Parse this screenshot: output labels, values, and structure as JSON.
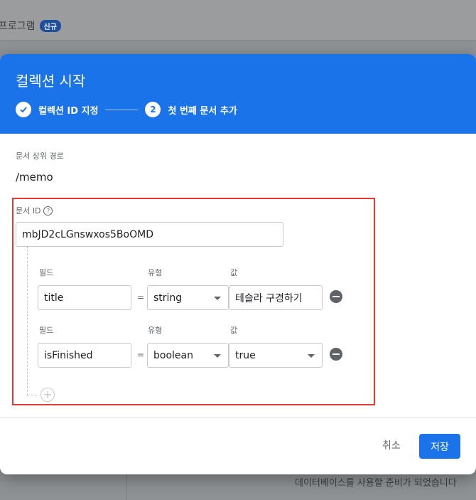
{
  "background": {
    "breadcrumb": "프로그램",
    "badge": "신규",
    "footer_text": "데이터베이스를 사용할 준비가 되었습니다"
  },
  "dialog": {
    "title": "컬렉션 시작",
    "steps": [
      {
        "number": "✓",
        "label": "컬렉션 ID 지정"
      },
      {
        "number": "2",
        "label": "첫 번째 문서 추가"
      }
    ],
    "parent_path_label": "문서 상위 경로",
    "parent_path_value": "/memo",
    "doc_id_label": "문서 ID",
    "doc_id_value": "mbJD2cLGnswxos5BoOMD",
    "rows": [
      {
        "field_label": "필드",
        "type_label": "유형",
        "value_label": "값",
        "field": "title",
        "eq": "=",
        "type": "string",
        "value": "테슬라 구경하기"
      },
      {
        "field_label": "필드",
        "type_label": "유형",
        "value_label": "값",
        "field": "isFinished",
        "eq": "=",
        "type": "boolean",
        "value": "true"
      }
    ],
    "cancel_label": "취소",
    "save_label": "저장"
  },
  "colors": {
    "accent": "#1a73e8",
    "highlight": "#e53935"
  }
}
